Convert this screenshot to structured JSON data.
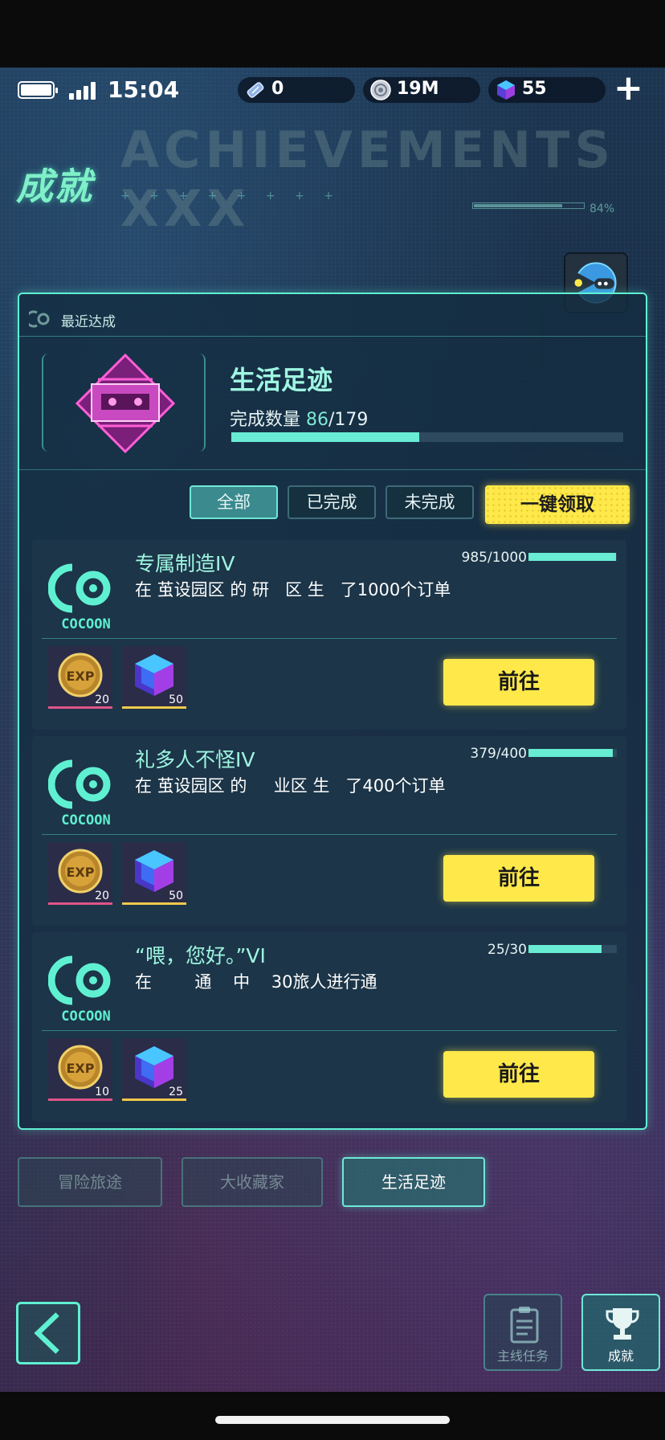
{
  "status": {
    "time": "15:04",
    "currencies": [
      {
        "icon": "ticket-icon",
        "value": "0"
      },
      {
        "icon": "coin-icon",
        "value": "19M"
      },
      {
        "icon": "gem-icon",
        "value": "55"
      }
    ]
  },
  "header": {
    "title": "成就",
    "deco_text": "ACHIEVEMENTS XXX",
    "deco_percent": "84%"
  },
  "panel": {
    "section_label": "最近达成",
    "category": {
      "name": "生活足迹",
      "count_label": "完成数量",
      "done": "86",
      "total": "/179",
      "progress": 0.48
    },
    "filters": [
      "全部",
      "已完成",
      "未完成"
    ],
    "active_filter": "全部",
    "claim_all_label": "一键领取"
  },
  "achievements": [
    {
      "title": "专属制造IV",
      "desc": "在 茧设园区 的 研   区 生   了1000个订单",
      "progress_text": "985/1000",
      "progress": 0.985,
      "rewards": [
        {
          "type": "exp",
          "icon": "exp-coin-icon",
          "qty": "20"
        },
        {
          "type": "gem",
          "icon": "gem-icon",
          "qty": "50"
        }
      ],
      "action": "前往",
      "logo_text": "COCOON"
    },
    {
      "title": "礼多人不怪IV",
      "desc": "在 茧设园区 的     业区 生   了400个订单",
      "progress_text": "379/400",
      "progress": 0.9475,
      "rewards": [
        {
          "type": "exp",
          "icon": "exp-coin-icon",
          "qty": "20"
        },
        {
          "type": "gem",
          "icon": "gem-icon",
          "qty": "50"
        }
      ],
      "action": "前往",
      "logo_text": "COCOON"
    },
    {
      "title": "“喂，您好。”VI",
      "desc": "在        通    中    30旅人进行通",
      "progress_text": "25/30",
      "progress": 0.833,
      "rewards": [
        {
          "type": "exp",
          "icon": "exp-coin-icon",
          "qty": "10"
        },
        {
          "type": "gem",
          "icon": "gem-icon",
          "qty": "25"
        }
      ],
      "action": "前往",
      "logo_text": "COCOON"
    }
  ],
  "category_tabs": [
    "冒险旅途",
    "大收藏家",
    "生活足迹"
  ],
  "active_category_tab": "生活足迹",
  "bottom_nav": [
    {
      "label": "主线任务",
      "icon": "clipboard-icon"
    },
    {
      "label": "成就",
      "icon": "trophy-icon"
    }
  ],
  "colors": {
    "accent": "#5ff0d2",
    "button_yellow": "#ffe94a",
    "title_mint": "#9ef6e1"
  }
}
